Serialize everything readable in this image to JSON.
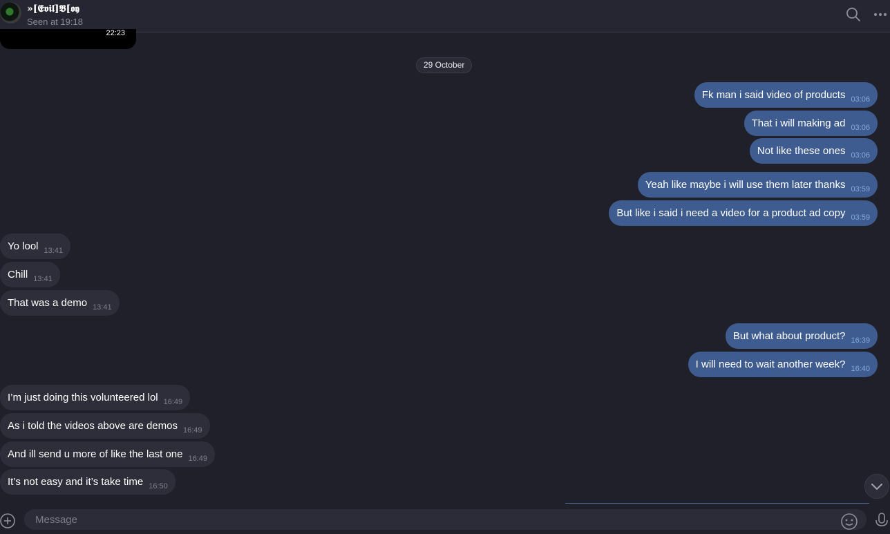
{
  "header": {
    "contact_name": "»[𝕰𝖛𝖎𝖑]𝕭[𝖔𝖞",
    "status": "Seen at 19:18",
    "search_icon": "search-icon",
    "more_icon": "more-icon"
  },
  "top_media": {
    "time": "22:23"
  },
  "date_separator": "29 October",
  "messages": [
    {
      "dir": "out",
      "text": "Fk man i said video of products",
      "time": "03:06"
    },
    {
      "dir": "out",
      "text": "That i will making ad",
      "time": "03:06"
    },
    {
      "dir": "out",
      "text": "Not like these ones",
      "time": "03:06"
    },
    {
      "dir": "out",
      "text": "Yeah like maybe i will use them later thanks",
      "time": "03:59"
    },
    {
      "dir": "out",
      "text": "But like i said i need a video for a product ad copy",
      "time": "03:59"
    },
    {
      "dir": "in",
      "text": "Yo lool",
      "time": "13:41"
    },
    {
      "dir": "in",
      "text": "Chill",
      "time": "13:41"
    },
    {
      "dir": "in",
      "text": "That was a demo",
      "time": "13:41"
    },
    {
      "dir": "out",
      "text": "But what about product?",
      "time": "16:39"
    },
    {
      "dir": "out",
      "text": "I will need to wait another week?",
      "time": "16:40"
    },
    {
      "dir": "in",
      "text": "I’m just doing this volunteered lol",
      "time": "16:49"
    },
    {
      "dir": "in",
      "text": "As i told the videos above are demos",
      "time": "16:49"
    },
    {
      "dir": "in",
      "text": "And ill send u more of like the last one",
      "time": "16:49"
    },
    {
      "dir": "in",
      "text": "It’s not easy and it’s take time",
      "time": "16:50"
    }
  ],
  "composer": {
    "placeholder": "Message",
    "attach_icon": "attach-icon",
    "emoji_icon": "emoji-icon",
    "mic_icon": "microphone-icon"
  },
  "colors": {
    "background": "#1f2029",
    "incoming_bubble": "#2d2e39",
    "outgoing_bubble": "#3e5c8f",
    "outgoing_time": "#86a9dc"
  }
}
